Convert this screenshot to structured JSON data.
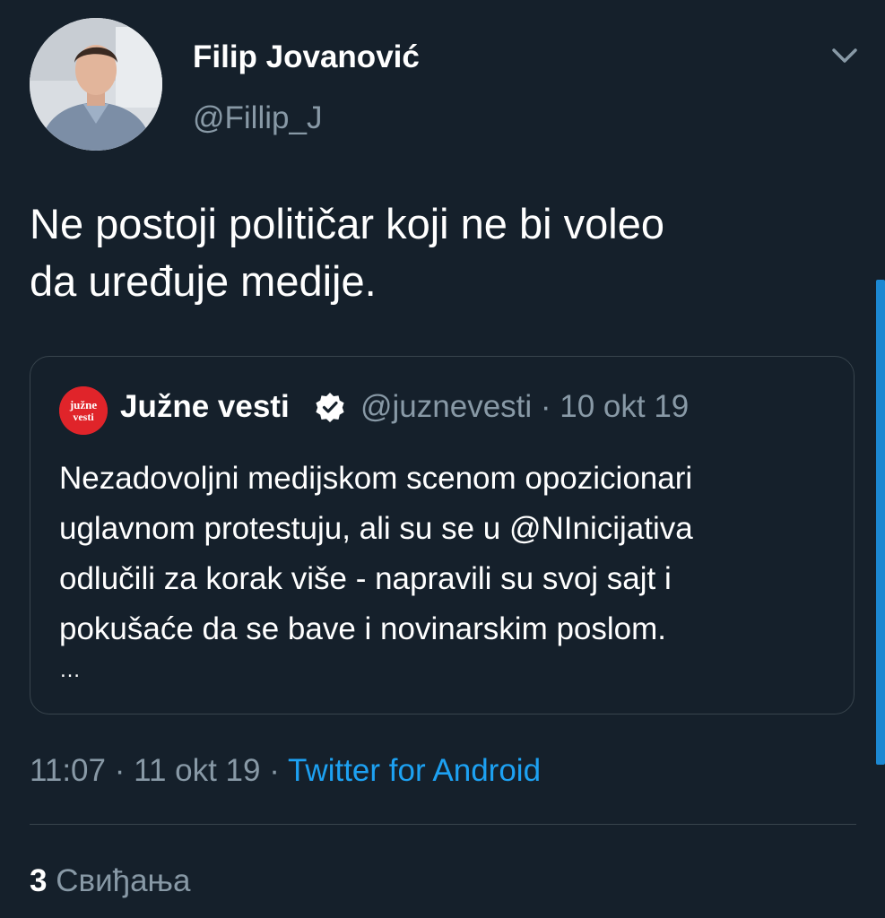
{
  "tweet": {
    "author": {
      "display_name": "Filip Jovanović",
      "handle": "@Fillip_J"
    },
    "menu_icon": "chevron-down-icon",
    "text_lines": [
      "Ne postoji političar koji ne bi voleo",
      "da uređuje medije."
    ],
    "timestamp": "11:07 · 11 okt 19 · ",
    "source": "Twitter for Android",
    "likes": {
      "count": "3",
      "label": "Свиђања"
    }
  },
  "quoted_tweet": {
    "logo_text_top": "južne",
    "logo_text_bottom": "vesti",
    "name": "Južne vesti",
    "verified_icon": "verified-badge-icon",
    "meta": "@juznevesti · 10 okt 19",
    "text_lines": [
      "Nezadovoljni medijskom scenom opozicionari",
      "uglavnom protestuju, ali su se u @NInicijativa",
      "odlučili za korak više - napravili su svoj sajt i",
      "pokušaće da se bave i novinarskim poslom."
    ],
    "ellipsis": "…"
  },
  "colors": {
    "background": "#15202b",
    "text_primary": "#ffffff",
    "text_secondary": "#8899a6",
    "link": "#1da1f2",
    "border": "#38444d",
    "logo_red": "#e0242a"
  }
}
